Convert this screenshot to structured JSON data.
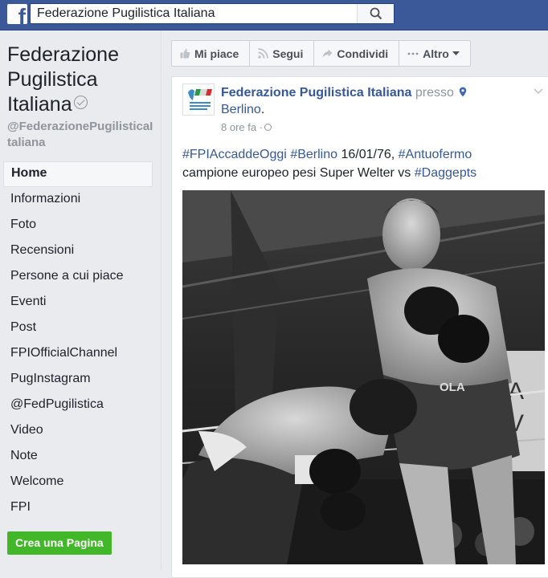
{
  "topbar": {
    "logo": "f",
    "search_value": "Federazione Pugilistica Italiana",
    "search_icon": "search-icon"
  },
  "sidebar": {
    "page_name": "Federazione Pugilistica Italiana",
    "handle": "@FederazionePugilisticaItaliana",
    "nav": [
      {
        "label": "Home",
        "active": true
      },
      {
        "label": "Informazioni"
      },
      {
        "label": "Foto"
      },
      {
        "label": "Recensioni"
      },
      {
        "label": "Persone a cui piace"
      },
      {
        "label": "Eventi"
      },
      {
        "label": "Post"
      },
      {
        "label": "FPIOfficialChannel"
      },
      {
        "label": "PugInstagram"
      },
      {
        "label": "@FedPugilistica"
      },
      {
        "label": "Video"
      },
      {
        "label": "Note"
      },
      {
        "label": "Welcome"
      },
      {
        "label": "FPI"
      }
    ],
    "create_page": "Crea una Pagina"
  },
  "actions": {
    "like": "Mi piace",
    "follow": "Segui",
    "share": "Condividi",
    "more": "Altro"
  },
  "post": {
    "author": "Federazione Pugilistica Italiana",
    "at": "presso",
    "place": "Berlino",
    "place_suffix": ".",
    "time": "8 ore fa ·",
    "text": {
      "tag1": "#FPIAccaddeOggi",
      "tag2": "#Berlino",
      "date": "16/01/76,",
      "tag3": "#Antuofermo",
      "line2": "campione europeo pesi Super Welter vs",
      "tag4": "#Daggepts"
    }
  },
  "colors": {
    "brand": "#3b5998",
    "link": "#365899",
    "create_button": "#42b72a"
  }
}
